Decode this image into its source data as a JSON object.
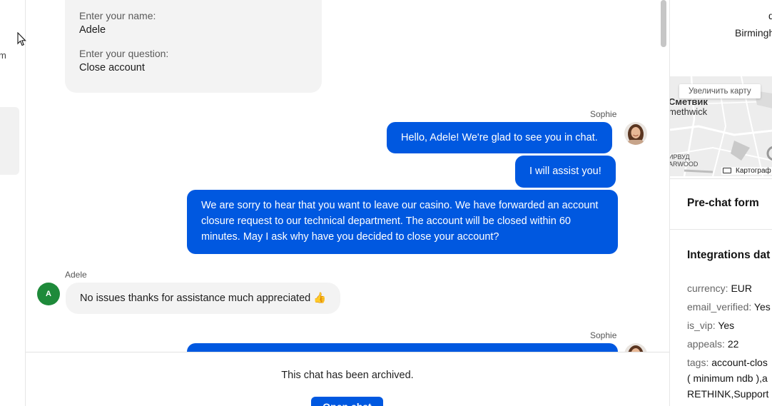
{
  "left_strip": {
    "cut_text": "m"
  },
  "form": {
    "name_label": "Enter your name:",
    "name_value": "Adele",
    "question_label": "Enter your question:",
    "question_value": "Close account"
  },
  "messages": {
    "agent_name": "Sophie",
    "agent_msg_1": "Hello, Adele! We're glad to see you in chat.",
    "agent_msg_2": "I will assist you!",
    "agent_msg_3": "We are sorry to hear that you want to leave our casino. We have forwarded an account closure request to our technical department. The account will be closed within 60 minutes. May I ask why have you decided to close your account?",
    "user_name": "Adele",
    "user_initial": "A",
    "user_msg_1": "No issues thanks for assistance much appreciated 👍",
    "agent_name_2": "Sophie"
  },
  "footer": {
    "archived_text": "This chat has been archived.",
    "open_button": "Open chat"
  },
  "right_panel": {
    "address_line_1": "d",
    "address_line_2": "Birmingh",
    "map": {
      "zoom_button": "Увеличить карту",
      "label_1": "Сметвик",
      "label_2": "methwick",
      "label_3a": "ИРВУД",
      "label_3b": "ARWOOD",
      "attribution": "Картограф"
    },
    "prechat_title": "Pre-chat form",
    "integrations_title": "Integrations dat",
    "fields": [
      {
        "key": "currency:",
        "value": "EUR"
      },
      {
        "key": "email_verified:",
        "value": "Yes"
      },
      {
        "key": "is_vip:",
        "value": "Yes"
      },
      {
        "key": "appeals:",
        "value": "22"
      },
      {
        "key": "tags:",
        "value": "account-clos"
      }
    ],
    "tags_line_2": "( minimum ndb ),a",
    "tags_line_3": "RETHINK,Support"
  },
  "colors": {
    "agent_bubble": "#0058e0",
    "user_bubble": "#f3f3f3",
    "user_avatar": "#1e8a3a"
  }
}
